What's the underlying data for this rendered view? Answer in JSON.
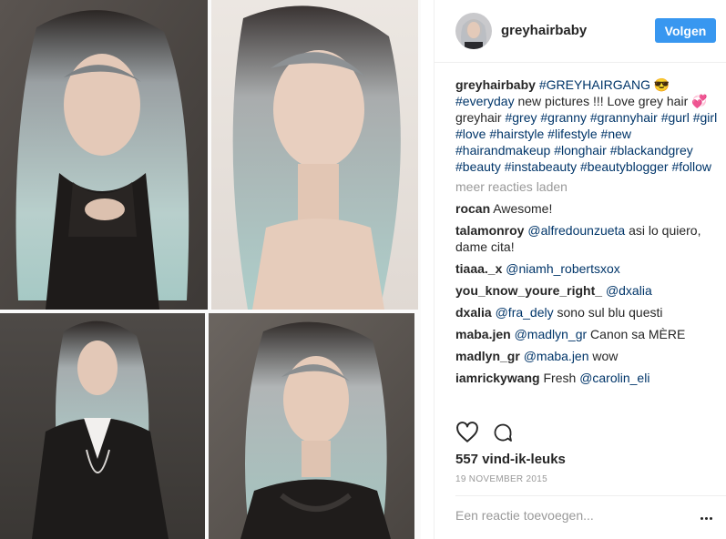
{
  "post": {
    "username": "greyhairbaby",
    "follow_label": "Volgen",
    "caption_user": "greyhairbaby",
    "caption_parts": [
      {
        "t": "tag",
        "v": "#GREYHAIRGANG"
      },
      {
        "t": "text",
        "v": " 😎 "
      },
      {
        "t": "tag",
        "v": "#everyday"
      },
      {
        "t": "text",
        "v": " new pictures !!! Love grey hair 💞 greyhair "
      },
      {
        "t": "tag",
        "v": "#grey"
      },
      {
        "t": "text",
        "v": " "
      },
      {
        "t": "tag",
        "v": "#granny"
      },
      {
        "t": "text",
        "v": " "
      },
      {
        "t": "tag",
        "v": "#grannyhair"
      },
      {
        "t": "text",
        "v": " "
      },
      {
        "t": "tag",
        "v": "#gurl"
      },
      {
        "t": "text",
        "v": " "
      },
      {
        "t": "tag",
        "v": "#girl"
      },
      {
        "t": "text",
        "v": " "
      },
      {
        "t": "tag",
        "v": "#love"
      },
      {
        "t": "text",
        "v": " "
      },
      {
        "t": "tag",
        "v": "#hairstyle"
      },
      {
        "t": "text",
        "v": " "
      },
      {
        "t": "tag",
        "v": "#lifestyle"
      },
      {
        "t": "text",
        "v": " "
      },
      {
        "t": "tag",
        "v": "#new"
      },
      {
        "t": "text",
        "v": " "
      },
      {
        "t": "tag",
        "v": "#hairandmakeup"
      },
      {
        "t": "text",
        "v": " "
      },
      {
        "t": "tag",
        "v": "#longhair"
      },
      {
        "t": "text",
        "v": " "
      },
      {
        "t": "tag",
        "v": "#blackandgrey"
      },
      {
        "t": "text",
        "v": " "
      },
      {
        "t": "tag",
        "v": "#beauty"
      },
      {
        "t": "text",
        "v": " "
      },
      {
        "t": "tag",
        "v": "#instabeauty"
      },
      {
        "t": "text",
        "v": " "
      },
      {
        "t": "tag",
        "v": "#beautyblogger"
      },
      {
        "t": "text",
        "v": " "
      },
      {
        "t": "tag",
        "v": "#follow"
      }
    ],
    "load_more_label": "meer reacties laden",
    "comments": [
      {
        "user": "rocan",
        "parts": [
          {
            "t": "text",
            "v": "Awesome!"
          }
        ]
      },
      {
        "user": "talamonroy",
        "parts": [
          {
            "t": "tag",
            "v": "@alfredounzueta"
          },
          {
            "t": "text",
            "v": " asi lo quiero, dame cita!"
          }
        ]
      },
      {
        "user": "tiaaa._x",
        "parts": [
          {
            "t": "tag",
            "v": "@niamh_robertsxox"
          }
        ]
      },
      {
        "user": "you_know_youre_right_",
        "parts": [
          {
            "t": "tag",
            "v": "@dxalia"
          }
        ]
      },
      {
        "user": "dxalia",
        "parts": [
          {
            "t": "tag",
            "v": "@fra_dely"
          },
          {
            "t": "text",
            "v": " sono sul blu questi"
          }
        ]
      },
      {
        "user": "maba.jen",
        "parts": [
          {
            "t": "tag",
            "v": "@madlyn_gr"
          },
          {
            "t": "text",
            "v": " Canon sa MÈRE"
          }
        ]
      },
      {
        "user": "madlyn_gr",
        "parts": [
          {
            "t": "tag",
            "v": "@maba.jen"
          },
          {
            "t": "text",
            "v": " wow"
          }
        ]
      },
      {
        "user": "iamrickywang",
        "parts": [
          {
            "t": "text",
            "v": "Fresh "
          },
          {
            "t": "tag",
            "v": "@carolin_eli"
          }
        ]
      }
    ],
    "likes": "557 vind-ik-leuks",
    "date": "19 NOVEMBER 2015",
    "add_comment_placeholder": "Een reactie toevoegen...",
    "icons": {
      "like": "heart-icon",
      "comment": "comment-icon",
      "more": "more-options-icon"
    },
    "colors": {
      "accent": "#3897f0",
      "link": "#003569",
      "muted": "#999999"
    }
  }
}
